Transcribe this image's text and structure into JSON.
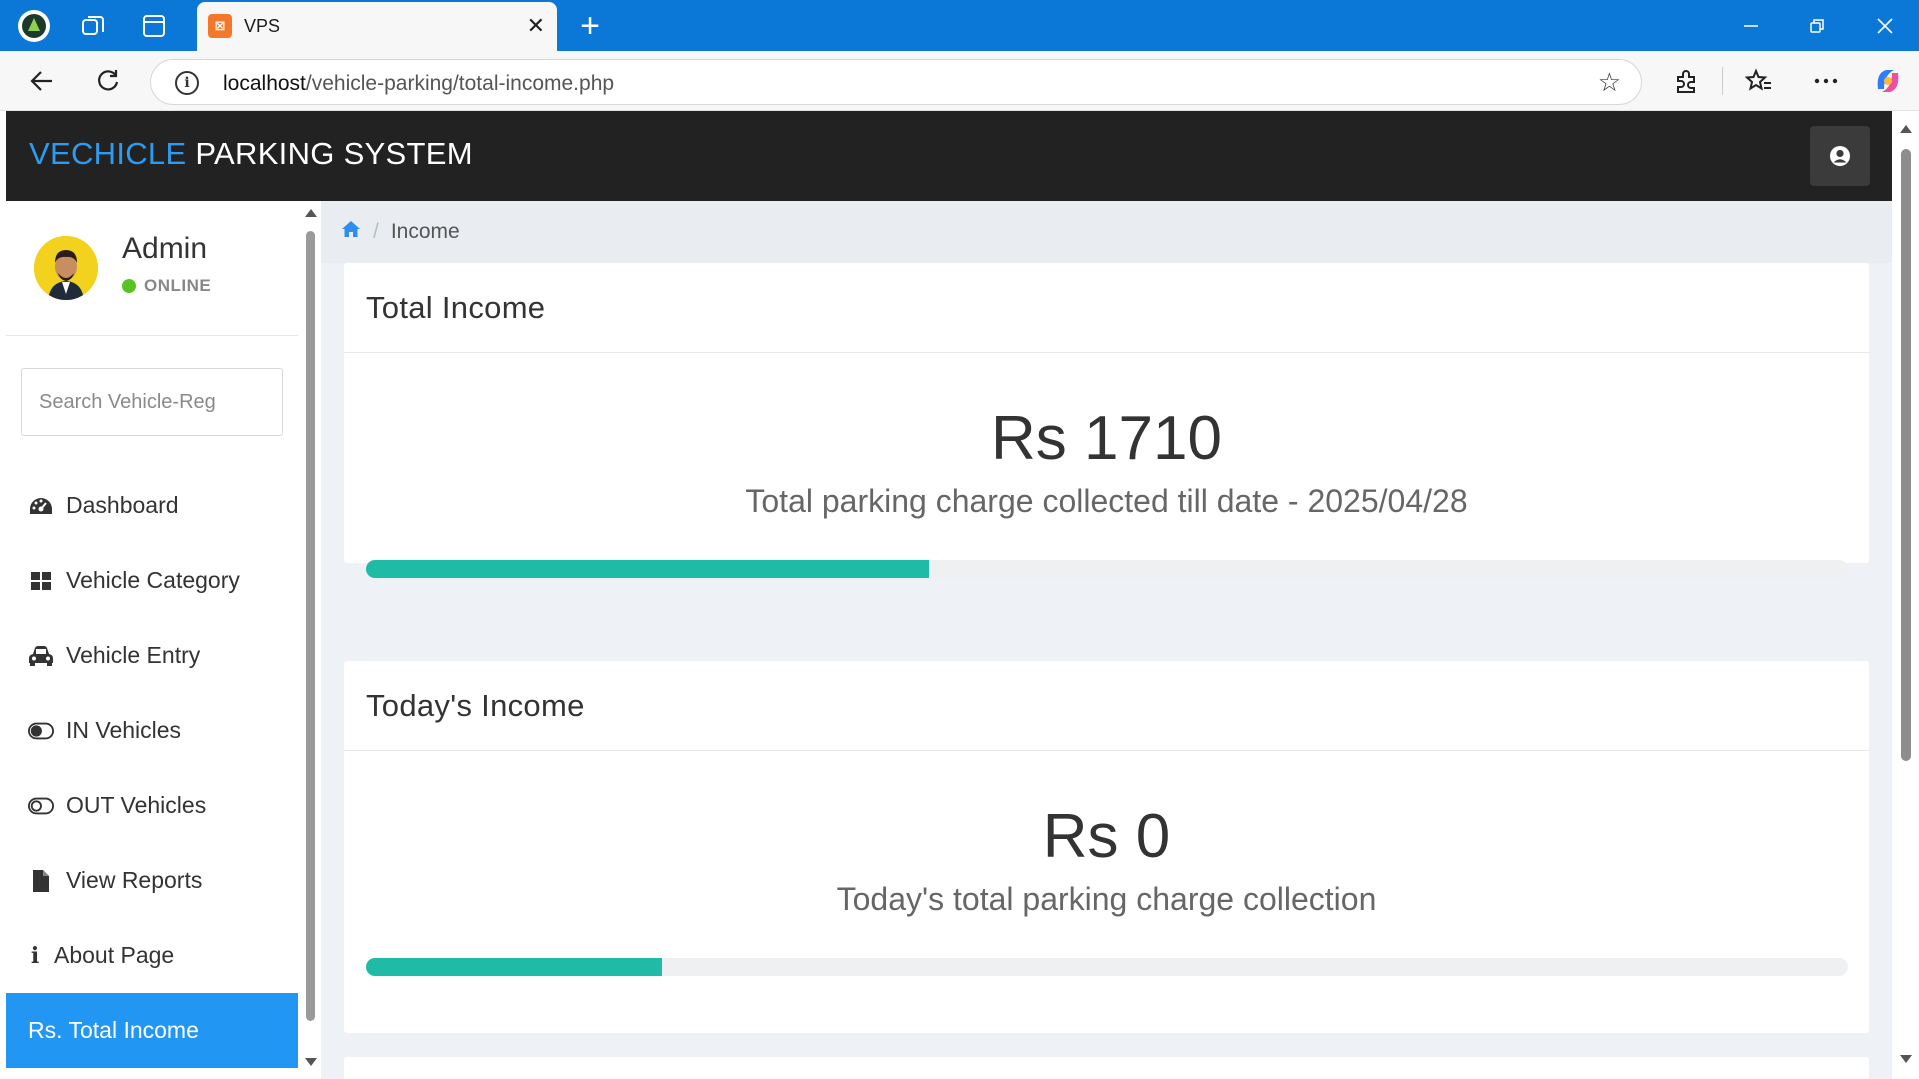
{
  "browser": {
    "tab_title": "VPS",
    "tab_favicon_text": "⊠",
    "url_host": "localhost",
    "url_path": "/vehicle-parking/total-income.php"
  },
  "navbar": {
    "brand_accent": "VECHICLE",
    "brand_rest": " PARKING SYSTEM"
  },
  "sidebar": {
    "user_name": "Admin",
    "user_status": "ONLINE",
    "search_placeholder": "Search Vehicle-Reg",
    "items": [
      {
        "label": "Dashboard",
        "icon": "dashboard-icon"
      },
      {
        "label": "Vehicle Category",
        "icon": "grid-icon"
      },
      {
        "label": "Vehicle Entry",
        "icon": "car-icon"
      },
      {
        "label": "IN Vehicles",
        "icon": "toggle-on-icon"
      },
      {
        "label": "OUT Vehicles",
        "icon": "toggle-off-icon"
      },
      {
        "label": "View Reports",
        "icon": "file-icon"
      },
      {
        "label": "About Page",
        "icon": "info-icon"
      },
      {
        "label": "Rs. Total Income",
        "icon": "",
        "active": true
      }
    ]
  },
  "breadcrumb": {
    "current": "Income"
  },
  "cards": [
    {
      "title": "Total Income",
      "amount": "Rs 1710",
      "subtitle": "Total parking charge collected till date - 2025/04/28",
      "progress": 0.38
    },
    {
      "title": "Today's Income",
      "amount": "Rs 0",
      "subtitle": "Today's total parking charge collection",
      "progress": 0.2
    }
  ],
  "colors": {
    "browser_accent": "#0b78d7",
    "navbar_bg": "#222222",
    "brand_accent": "#2e9bf0",
    "active_menu": "#2196f3",
    "progress_fill": "#1fbba6",
    "online": "#58c322"
  }
}
